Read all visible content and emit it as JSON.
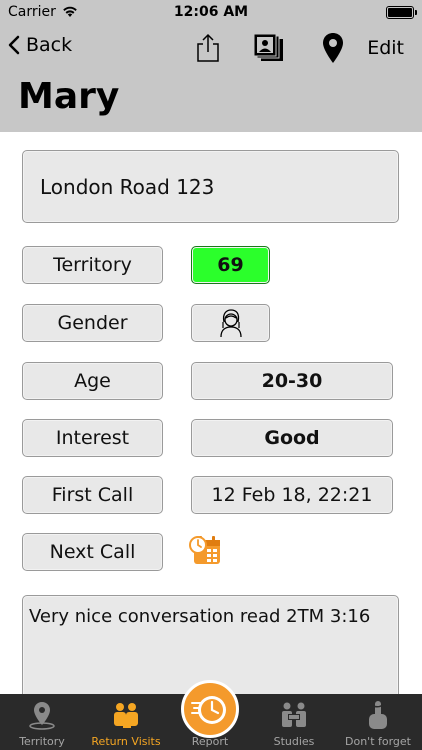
{
  "status": {
    "carrier": "Carrier",
    "time": "12:06 AM"
  },
  "nav": {
    "back_label": "Back",
    "edit_label": "Edit"
  },
  "title": "Mary",
  "address": "London Road 123",
  "fields": {
    "territory": {
      "label": "Territory",
      "value": "69"
    },
    "gender": {
      "label": "Gender"
    },
    "age": {
      "label": "Age",
      "value": "20-30"
    },
    "interest": {
      "label": "Interest",
      "value": "Good"
    },
    "first_call": {
      "label": "First Call",
      "value": "12 Feb 18, 22:21"
    },
    "next_call": {
      "label": "Next Call"
    }
  },
  "notes": "Very nice conversation read 2TM 3:16",
  "tabs": [
    {
      "label": "Territory",
      "icon": "map-pin-icon"
    },
    {
      "label": "Return Visits",
      "icon": "people-icon"
    },
    {
      "label": "Report",
      "icon": "clock-report-icon"
    },
    {
      "label": "Studies",
      "icon": "studies-icon"
    },
    {
      "label": "Don't forget",
      "icon": "finger-string-icon"
    }
  ],
  "colors": {
    "territory_bg": "#2bff2b",
    "active_tab": "#f5a623",
    "tabbar_bg": "#2a2a2a",
    "header_bg": "#c7c7c7"
  }
}
